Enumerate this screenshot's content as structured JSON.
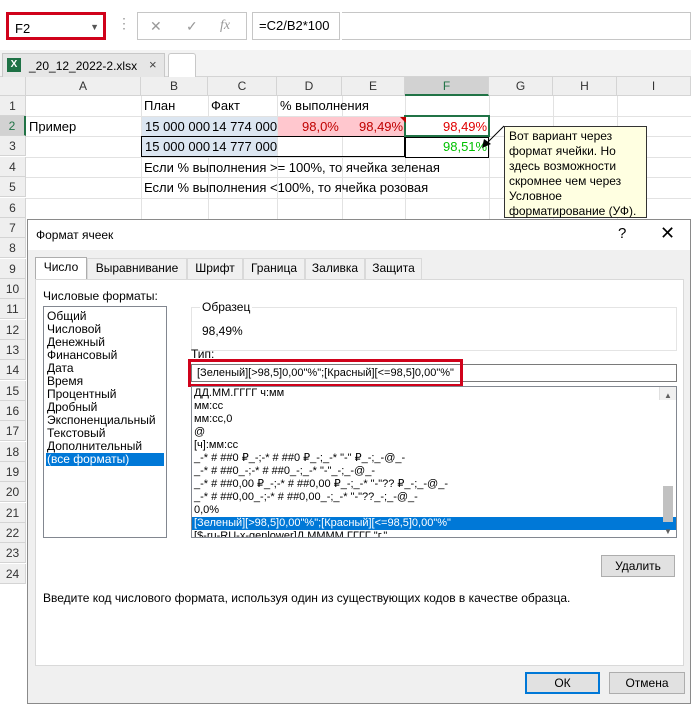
{
  "formula_bar": {
    "cell_ref": "F2",
    "formula": "=C2/B2*100",
    "cancel_icon": "✕",
    "enter_icon": "✓",
    "fx_label": "fx"
  },
  "file_tab": {
    "icon": "X",
    "name": "_20_12_2022-2.xlsx",
    "close": "×"
  },
  "columns": [
    "A",
    "B",
    "C",
    "D",
    "E",
    "F",
    "G",
    "H",
    "I"
  ],
  "rows": [
    "1",
    "2",
    "3",
    "4",
    "5",
    "6",
    "7",
    "8",
    "9",
    "10",
    "11",
    "12",
    "13",
    "14",
    "15",
    "16",
    "17",
    "18",
    "19",
    "20",
    "21",
    "22",
    "23",
    "24"
  ],
  "cells": {
    "B1": "План",
    "C1": "Факт",
    "D1": "% выполнения",
    "A2": "Пример",
    "B2": "15 000 000",
    "C2": "14 774 000",
    "D2": "98,0%",
    "E2": "98,49%",
    "F2": "98,49%",
    "B3": "15 000 000",
    "C3": "14 777 000",
    "F3": "98,51%",
    "B4": "Если % выполнения >= 100%, то ячейка зеленая",
    "B5": "Если % выполнения <100%, то ячейка розовая"
  },
  "callout": "Вот вариант через формат ячейки. Но здесь возможности скромнее чем через Условное форматирование (УФ).",
  "dialog": {
    "title": "Формат ячеек",
    "help": "?",
    "close": "✕",
    "tabs": [
      "Число",
      "Выравнивание",
      "Шрифт",
      "Граница",
      "Заливка",
      "Защита"
    ],
    "categories_label": "Числовые форматы:",
    "categories": [
      "Общий",
      "Числовой",
      "Денежный",
      "Финансовый",
      "Дата",
      "Время",
      "Процентный",
      "Дробный",
      "Экспоненциальный",
      "Текстовый",
      "Дополнительный",
      "(все форматы)"
    ],
    "sample_label": "Образец",
    "sample_value": "98,49%",
    "type_label": "Тип:",
    "type_value": "[Зеленый][>98,5]0,00\"%\";[Красный][<=98,5]0,00\"%\"",
    "formats": [
      "ДД.ММ.ГГГГ ч:мм",
      "мм:сс",
      "мм:сс,0",
      "@",
      "[ч]:мм:сс",
      "_-* # ##0 ₽_-;-* # ##0 ₽_-;_-* \"-\" ₽_-;_-@_-",
      "_-* # ##0_-;-* # ##0_-;_-* \"-\"_-;_-@_-",
      "_-* # ##0,00 ₽_-;-* # ##0,00 ₽_-;_-* \"-\"?? ₽_-;_-@_-",
      "_-* # ##0,00_-;-* # ##0,00_-;_-* \"-\"??_-;_-@_-",
      "0,0%",
      "[Зеленый][>98,5]0,00\"%\";[Красный][<=98,5]0,00\"%\"",
      "[$-ru-RU-x-genlower]Д ММММ ГГГГ \"г.\""
    ],
    "delete_button": "Удалить",
    "hint": "Введите код числового формата, используя один из существующих кодов в качестве образца.",
    "ok_button": "ОК",
    "cancel_button": "Отмена"
  },
  "colors": {
    "accent": "#217346",
    "selection": "#0078d7",
    "highlight": "#d0021b",
    "pink": "#ffc7ce",
    "blue_fill": "#dce6f1",
    "green_text": "#00c000",
    "red_text": "#e00000"
  }
}
